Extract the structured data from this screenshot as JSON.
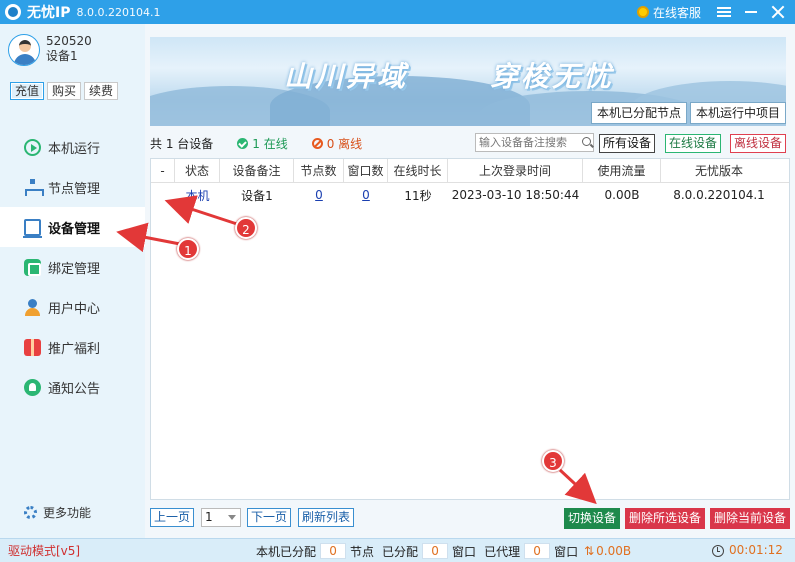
{
  "titlebar": {
    "app_name": "无忧IP",
    "version": "8.0.0.220104.1",
    "service_label": "在线客服"
  },
  "user": {
    "id": "520520",
    "device": "设备1"
  },
  "account_buttons": [
    "充值",
    "购买",
    "续费"
  ],
  "nav": [
    {
      "label": "本机运行",
      "icon": "play-icon"
    },
    {
      "label": "节点管理",
      "icon": "node-icon"
    },
    {
      "label": "设备管理",
      "icon": "device-icon",
      "active": true
    },
    {
      "label": "绑定管理",
      "icon": "bind-icon"
    },
    {
      "label": "用户中心",
      "icon": "user-icon"
    },
    {
      "label": "推广福利",
      "icon": "gift-icon"
    },
    {
      "label": "通知公告",
      "icon": "bell-icon"
    }
  ],
  "more_label": "更多功能",
  "banner": {
    "title_left": "山川异域",
    "title_right": "穿梭无忧",
    "tabs": [
      "本机已分配节点",
      "本机运行中项目"
    ]
  },
  "filter": {
    "total": "共 1 台设备",
    "online": "1 在线",
    "offline": "0 离线",
    "search_placeholder": "输入设备备注搜索",
    "buttons": [
      "所有设备",
      "在线设备",
      "离线设备"
    ]
  },
  "table": {
    "headers": [
      "-",
      "状态",
      "设备备注",
      "节点数",
      "窗口数",
      "在线时长",
      "上次登录时间",
      "使用流量",
      "无忧版本"
    ],
    "rows": [
      [
        "",
        "本机",
        "设备1",
        "0",
        "0",
        "11秒",
        "2023-03-10 18:50:44",
        "0.00B",
        "8.0.0.220104.1"
      ]
    ]
  },
  "pager": {
    "prev": "上一页",
    "page": "1",
    "next": "下一页",
    "refresh": "刷新列表"
  },
  "actions": {
    "switch": "切换设备",
    "delete_selected": "删除所选设备",
    "delete_current": "删除当前设备"
  },
  "annotations": [
    "1",
    "2",
    "3"
  ],
  "statusbar": {
    "mode": "驱动模式[v5]",
    "assigned_label": "本机已分配",
    "assigned_value": "0",
    "nodes_label": "节点",
    "allocated_label": "已分配",
    "allocated_value": "0",
    "window_label": "窗口",
    "proxied_label": "已代理",
    "proxied_value": "0",
    "window_label2": "窗口",
    "speed": "0.00B",
    "timer": "00:01:12"
  },
  "colors": {
    "accent": "#2ea0e8",
    "online": "#2bb673",
    "danger": "#d9364a",
    "switch": "#1e8a4c"
  }
}
